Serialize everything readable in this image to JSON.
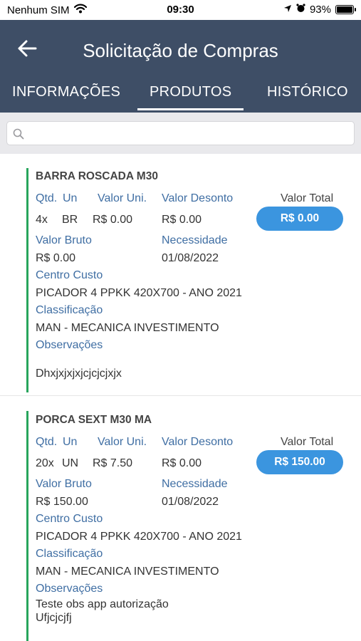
{
  "status_bar": {
    "carrier": "Nenhum SIM",
    "time": "09:30",
    "battery": "93%",
    "battery_level": 0.93
  },
  "header": {
    "title": "Solicitação de Compras",
    "back_icon": "arrow-left-icon"
  },
  "tabs": [
    {
      "label": "INFORMAÇÕES",
      "active": false
    },
    {
      "label": "PRODUTOS",
      "active": true
    },
    {
      "label": "HISTÓRICO",
      "active": false
    }
  ],
  "search": {
    "placeholder": "",
    "value": "",
    "icon": "search-icon"
  },
  "products": [
    {
      "name": "BARRA ROSCADA M30",
      "labels": {
        "qtd": "Qtd.",
        "un": "Un",
        "valor_uni": "Valor Uni.",
        "valor_desconto": "Valor Desonto",
        "valor_total": "Valor Total",
        "valor_bruto": "Valor Bruto",
        "necessidade": "Necessidade",
        "centro_custo": "Centro Custo",
        "classificacao": "Classificação",
        "observacoes": "Observações"
      },
      "qtd": "4x",
      "un": "BR",
      "valor_uni": "R$ 0.00",
      "valor_desconto": "R$ 0.00",
      "valor_total": "R$ 0.00",
      "valor_bruto": "R$ 0.00",
      "necessidade": "01/08/2022",
      "centro_custo": "PICADOR 4 PPKK 420X700 - ANO 2021",
      "classificacao": "MAN - MECANICA INVESTIMENTO",
      "observacoes_line1": "",
      "observacoes_line2": "Dhxjxjxjxjcjcjcjxjx"
    },
    {
      "name": "PORCA SEXT M30 MA",
      "labels": {
        "qtd": "Qtd.",
        "un": "Un",
        "valor_uni": "Valor Uni.",
        "valor_desconto": "Valor Desonto",
        "valor_total": "Valor Total",
        "valor_bruto": "Valor Bruto",
        "necessidade": "Necessidade",
        "centro_custo": "Centro Custo",
        "classificacao": "Classificação",
        "observacoes": "Observações"
      },
      "qtd": "20x",
      "un": "UN",
      "valor_uni": "R$ 7.50",
      "valor_desconto": "R$ 0.00",
      "valor_total": "R$ 150.00",
      "valor_bruto": "R$ 150.00",
      "necessidade": "01/08/2022",
      "centro_custo": "PICADOR 4 PPKK 420X700 - ANO 2021",
      "classificacao": "MAN - MECANICA INVESTIMENTO",
      "observacoes_line1": "Teste obs app autorização",
      "observacoes_line2": "Ufjcjcjfj"
    }
  ]
}
